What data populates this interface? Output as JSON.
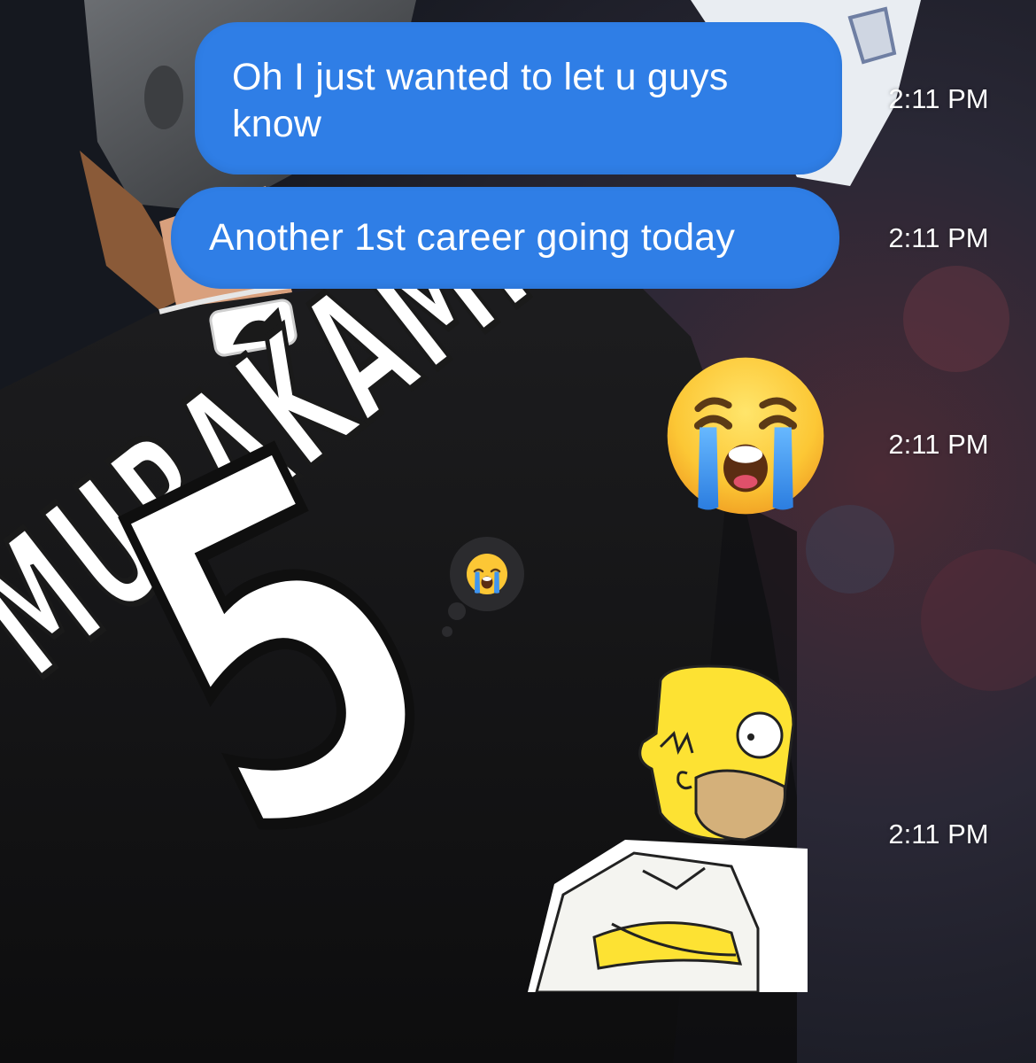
{
  "messages": [
    {
      "text": "Oh I just wanted to let u guys know",
      "time": "2:11 PM"
    },
    {
      "text": "Another 1st career going today",
      "time": "2:11 PM"
    },
    {
      "emoji": "loudly-crying-face",
      "time": "2:11 PM"
    },
    {
      "sticker": "homer-simpson-arms-crossed",
      "time": "2:11 PM"
    }
  ],
  "reaction": {
    "emoji": "loudly-crying-face"
  },
  "background": {
    "jersey_name": "MURAKAMI",
    "jersey_number": "5",
    "logo": "MLB"
  },
  "colors": {
    "bubble": "#2f7ee6",
    "timestamp": "#ffffff"
  }
}
